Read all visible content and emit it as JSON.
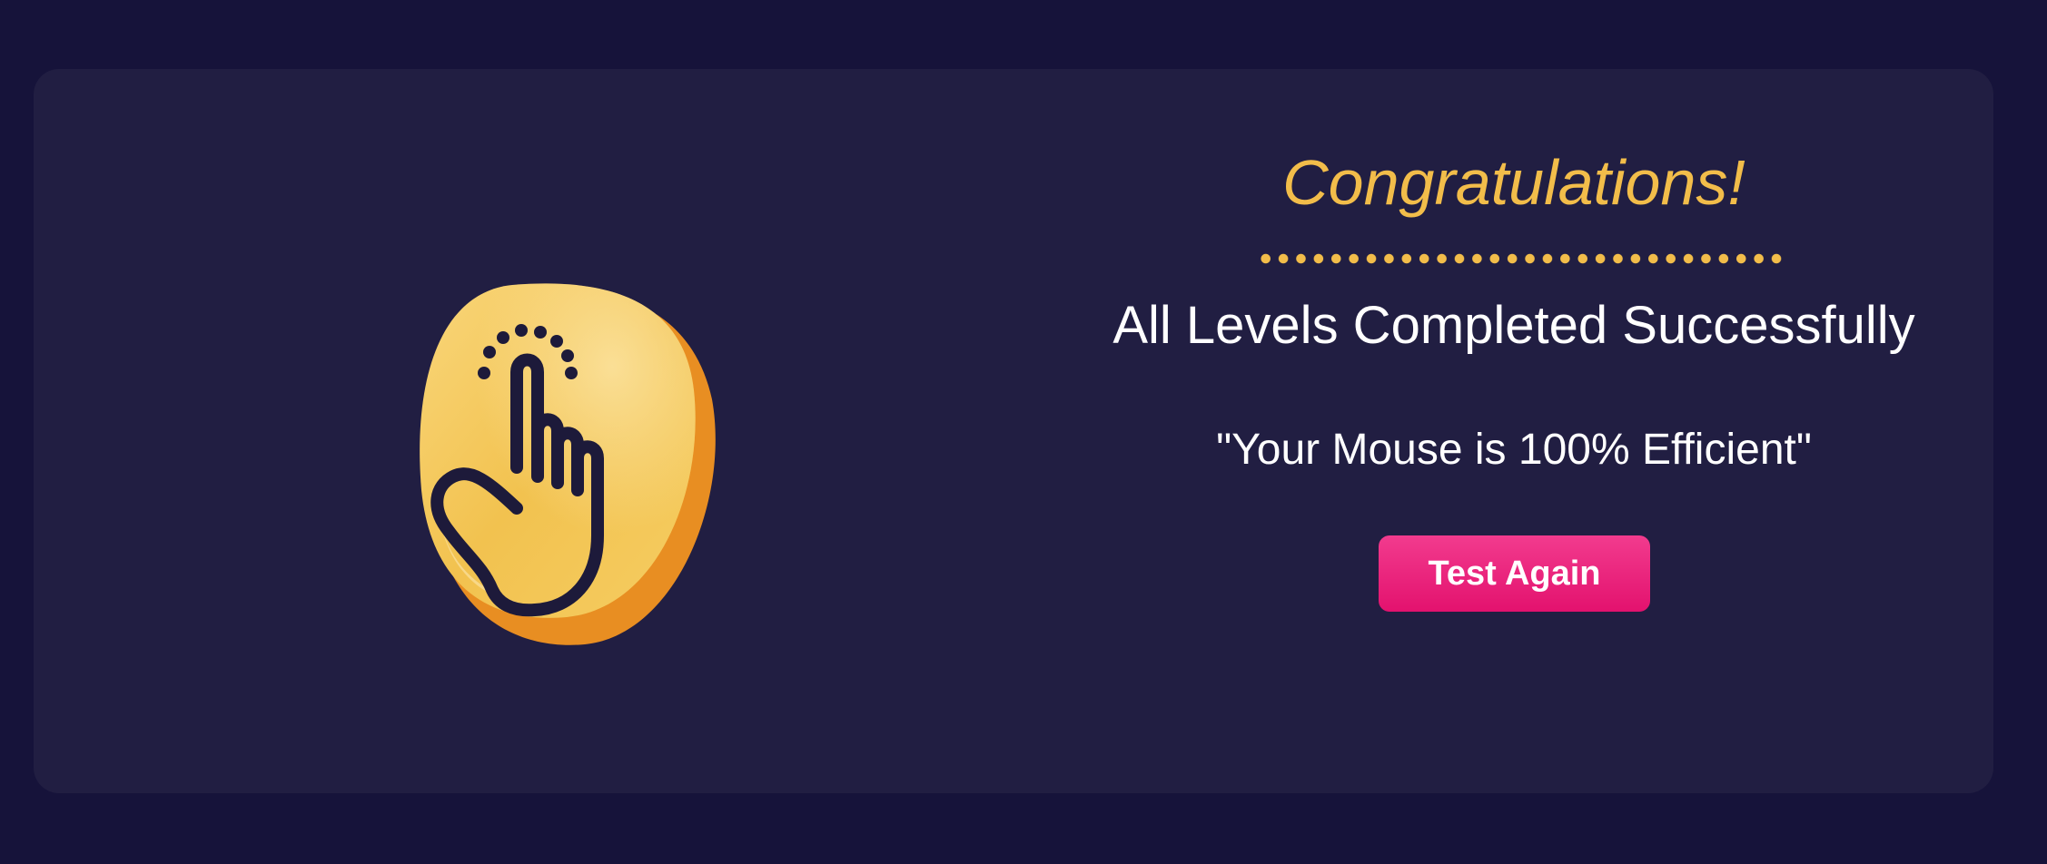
{
  "result_card": {
    "logo_icon": "tap-hand-icon",
    "title": "Congratulations!",
    "subtitle": "All Levels Completed Successfully",
    "efficiency_message": "\"Your Mouse is 100% Efficient\"",
    "button_label": "Test Again"
  },
  "colors": {
    "background": "#16133a",
    "card": "#211e42",
    "accent_gold": "#f2bd4a",
    "button_pink": "#e91a76",
    "text": "#ffffff"
  }
}
